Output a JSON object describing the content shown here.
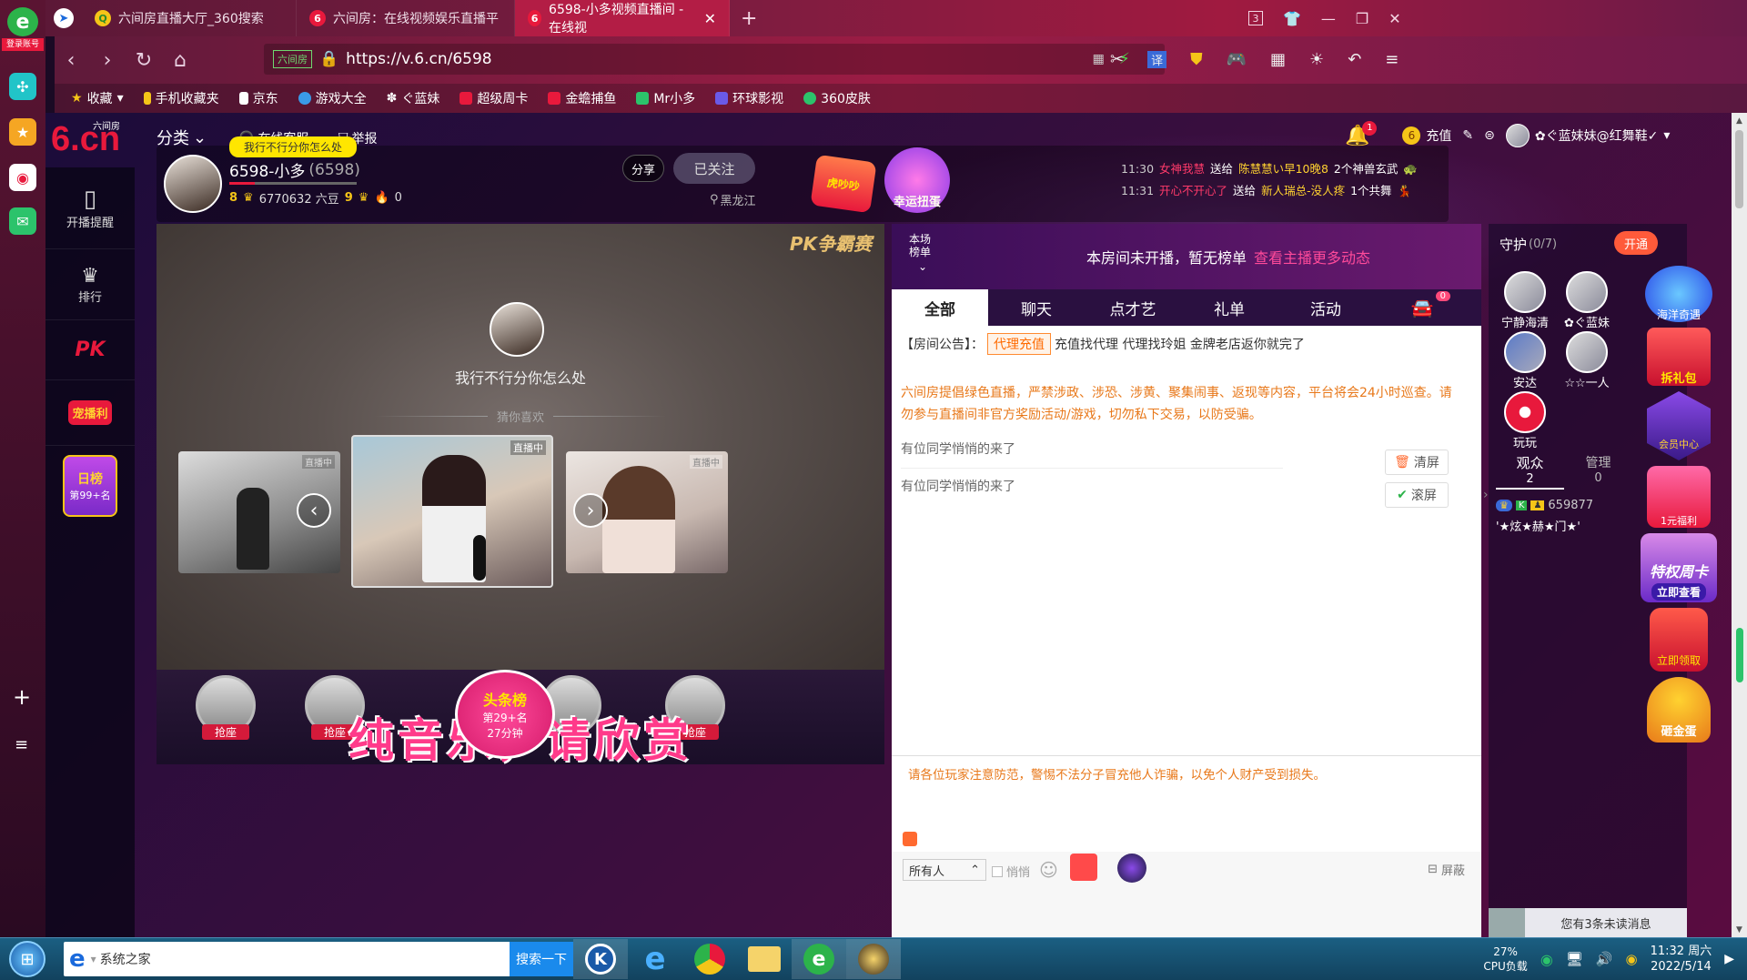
{
  "browser": {
    "tabs": [
      {
        "title": "六间房直播大厅_360搜索",
        "active": false
      },
      {
        "title": "六间房：在线视频娱乐直播平",
        "active": false
      },
      {
        "title": "6598-小多视频直播间 - 在线视",
        "active": true
      }
    ],
    "new_tab": "+",
    "tab_count": "3",
    "url_site_badge": "六间房",
    "url": "https://v.6.cn/6598",
    "login_badge": "登录账号",
    "translate": "译",
    "bookmarks": [
      "收藏",
      "手机收藏夹",
      "京东",
      "游戏大全",
      "ぐ蓝妹",
      "超级周卡",
      "金蟾捕鱼",
      "Mr小多",
      "环球影视",
      "360皮肤"
    ]
  },
  "site": {
    "logo": "6.cn",
    "logo_sub": "六间房",
    "nav": {
      "category": "分类",
      "service": "在线客服",
      "report": "举报"
    },
    "user": {
      "notif_count": "1",
      "recharge": "充值",
      "username": "✿ぐ蓝妹妹@红舞鞋✓"
    },
    "leftnav": [
      {
        "label": "开播提醒"
      },
      {
        "label": "排行"
      },
      {
        "label": "PK"
      },
      {
        "label": "宠播利"
      },
      {
        "label": "日榜",
        "sub": "第99+名"
      }
    ]
  },
  "anchor": {
    "tooltip": "我行不行分你怎么处",
    "name": "6598-小多",
    "id": "(6598)",
    "level_left": "8",
    "beans": "6770632 六豆",
    "level_right": "9",
    "fire_count": "0",
    "share": "分享",
    "follow": "已关注",
    "location": "黑龙江",
    "badge1": "虎吵吵",
    "badge2": "幸运扭蛋",
    "gifts": [
      {
        "time": "11:30",
        "from": "女神我慧",
        "verb": "送给",
        "to": "陈慧慧い早10晚8",
        "item": "2个神兽玄武"
      },
      {
        "time": "11:31",
        "from": "开心不开心了",
        "verb": "送给",
        "to": "新人瑞总-没人疼",
        "item": "1个共舞"
      }
    ]
  },
  "video": {
    "pk_logo": "PK争霸赛",
    "center_title": "我行不行分你怎么处",
    "guess_like": "猜你喜欢",
    "live_badge": "直播中",
    "banner_title": "纯音乐，请欣赏",
    "headline_tag": "头条榜",
    "headline_rank": "第29+名",
    "headline_time": "27分钟",
    "seat_label": "抢座"
  },
  "chat": {
    "rank_tab": "本场榜单",
    "no_rank": "本房间未开播，暂无榜单",
    "more_link": "查看主播更多动态",
    "tabs": [
      "全部",
      "聊天",
      "点才艺",
      "礼单",
      "活动"
    ],
    "car_badge": "0",
    "notice_label": "【房间公告】：",
    "notice_tag": "代理充值",
    "notice_text": "充值找代理 代理找玲姐 金牌老店返你就完了",
    "warning": "六间房提倡绿色直播，严禁涉政、涉恐、涉黄、聚集闹事、返现等内容，平台将会24小时巡查。请勿参与直播间非官方奖励活动/游戏，切勿私下交易，以防受骗。",
    "messages": [
      "有位同学悄悄的来了",
      "有位同学悄悄的来了"
    ],
    "clear": "清屏",
    "scroll": "滚屏",
    "safety_note": "请各位玩家注意防范，警惕不法分子冒充他人诈骗，以免个人财产受到损失。",
    "recipient": "所有人",
    "whisper": "悄悄",
    "block": "屏蔽"
  },
  "guard": {
    "title": "守护",
    "count": "(0/7)",
    "open": "开通",
    "members": [
      "宁静海清",
      "✿ぐ蓝妹",
      "安达",
      "☆☆一人",
      "玩玩"
    ],
    "audience_label": "观众",
    "audience_count": "2",
    "manage_label": "管理",
    "manage_count": "0",
    "user_id": "659877",
    "user_nick": "'★炫★赫★门★'",
    "unread": "您有3条未读消息"
  },
  "float_icons": [
    "海洋奇遇",
    "拆礼包",
    "会员中心",
    "1元福利",
    "特权周卡",
    "立即查看",
    "立即领取",
    "砸金蛋"
  ],
  "taskbar": {
    "search_placeholder": "系统之家",
    "search_button": "搜索一下",
    "cpu_percent": "27%",
    "cpu_label": "CPU负载",
    "time": "11:32 周六",
    "date": "2022/5/14"
  },
  "colors": {
    "accent_pink": "#ff4a7a",
    "gold": "#ffd230",
    "link_orange": "#ff6a00",
    "chat_purple": "#2a1040"
  }
}
